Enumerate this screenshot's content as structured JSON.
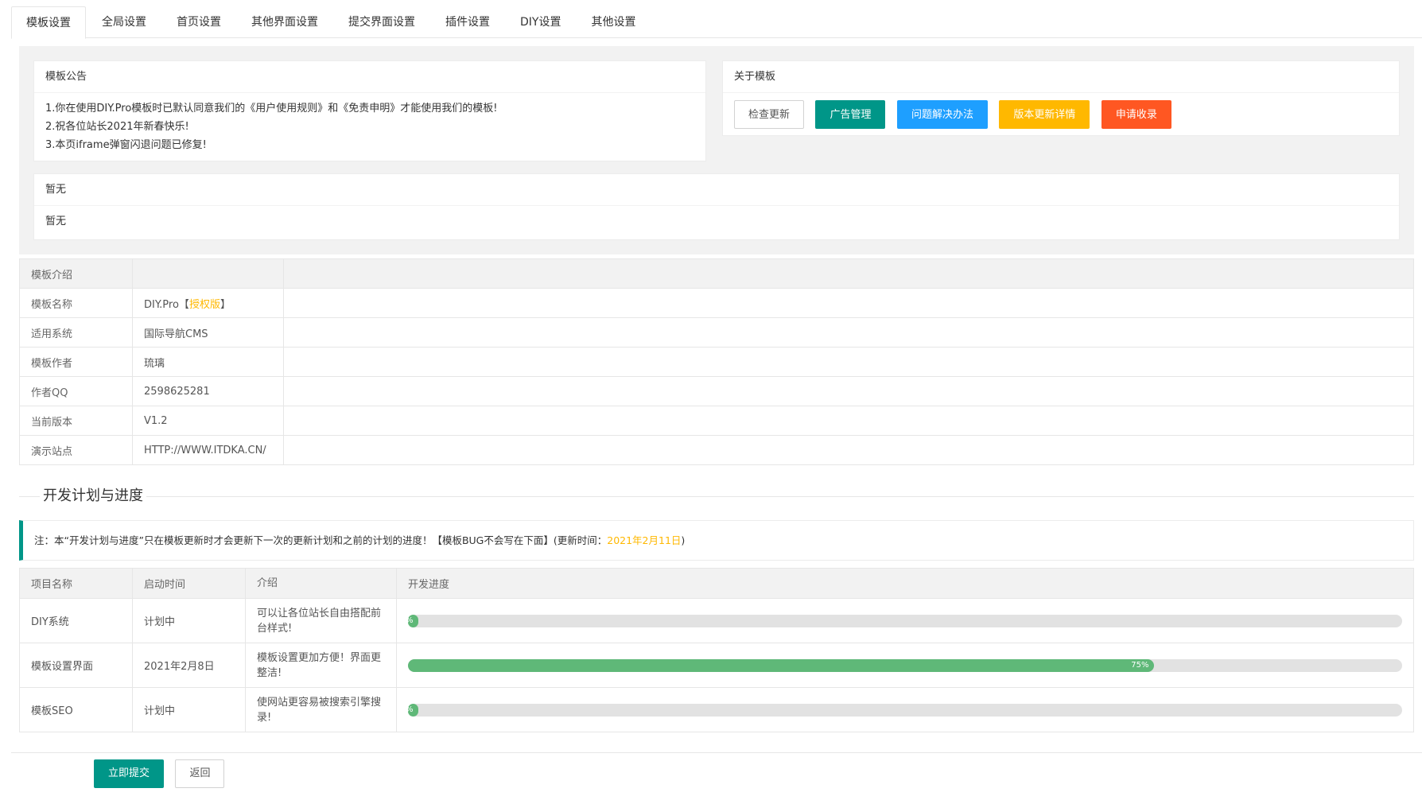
{
  "tabs": [
    "模板设置",
    "全局设置",
    "首页设置",
    "其他界面设置",
    "提交界面设置",
    "插件设置",
    "DIY设置",
    "其他设置"
  ],
  "notice": {
    "title": "模板公告",
    "lines": [
      "1.你在使用DIY.Pro模板时已默认同意我们的《用户使用规则》和《免责申明》才能使用我们的模板!",
      "2.祝各位站长2021年新春快乐!",
      "3.本页iframe弹窗闪退问题已修复!"
    ]
  },
  "about": {
    "title": "关于模板",
    "buttons": [
      "检查更新",
      "广告管理",
      "问题解决办法",
      "版本更新详情",
      "申请收录"
    ]
  },
  "misc": {
    "title": "暂无",
    "body": "暂无"
  },
  "intro": {
    "header": "模板介绍",
    "rows": [
      {
        "label": "模板名称",
        "value": "DIY.Pro",
        "bracket_open": "【",
        "highlight": "授权版",
        "bracket_close": "】"
      },
      {
        "label": "适用系统",
        "value": "国际导航CMS"
      },
      {
        "label": "模板作者",
        "value": "琉璃"
      },
      {
        "label": "作者QQ",
        "value": "2598625281"
      },
      {
        "label": "当前版本",
        "value": "V1.2"
      },
      {
        "label": "演示站点",
        "value": "HTTP://WWW.ITDKA.CN/"
      }
    ]
  },
  "plan": {
    "title": "开发计划与进度",
    "note_text": "注：本“开发计划与进度”只在模板更新时才会更新下一次的更新计划和之前的计划的进度！【模板BUG不会写在下面】(更新时间：",
    "note_date": "2021年2月11日",
    "note_end": ")",
    "headers": [
      "项目名称",
      "启动时间",
      "介绍",
      "开发进度"
    ],
    "rows": [
      {
        "name": "DIY系统",
        "start": "计划中",
        "desc": "可以让各位站长自由搭配前台样式!",
        "progress": 1,
        "progress_label": "1%"
      },
      {
        "name": "模板设置界面",
        "start": "2021年2月8日",
        "desc": "模板设置更加方便！界面更整洁!",
        "progress": 75,
        "progress_label": "75%"
      },
      {
        "name": "模板SEO",
        "start": "计划中",
        "desc": "使网站更容易被搜索引擎搜录!",
        "progress": 1,
        "progress_label": "1%"
      }
    ]
  },
  "footer": {
    "submit": "立即提交",
    "back": "返回"
  },
  "colors": {
    "teal": "#009688",
    "blue": "#1e9fff",
    "orange": "#ffb800",
    "red": "#ff5722",
    "green": "#5fb878"
  }
}
